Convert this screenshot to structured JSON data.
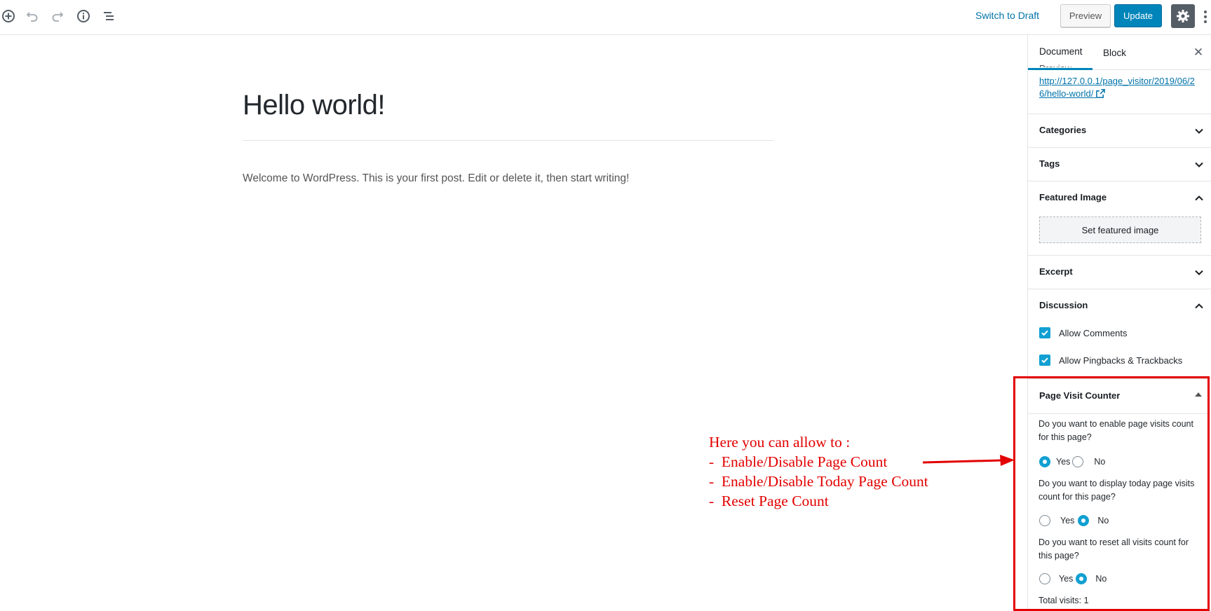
{
  "toolbar": {
    "icons": [
      "add-block-icon",
      "undo-icon",
      "redo-icon",
      "info-icon",
      "outline-icon",
      "gear-icon",
      "more-menu-icon"
    ],
    "switch_to_draft": "Switch to Draft",
    "preview": "Preview",
    "update": "Update"
  },
  "editor": {
    "title": "Hello world!",
    "body": "Welcome to WordPress. This is your first post. Edit or delete it, then start writing!"
  },
  "sidebar": {
    "tabs": [
      "Document",
      "Block"
    ],
    "active_tab": "Document",
    "preview_label": "Preview",
    "permalink": "http://127.0.0.1/page_visitor/2019/06/26/hello-world/",
    "panels": {
      "categories": "Categories",
      "tags": "Tags",
      "featured_image": "Featured Image",
      "set_featured_image": "Set featured image",
      "excerpt": "Excerpt",
      "discussion": "Discussion",
      "allow_comments": "Allow Comments",
      "allow_pingbacks": "Allow Pingbacks & Trackbacks"
    },
    "page_visit_counter": {
      "title": "Page Visit Counter",
      "q1": "Do you want to enable page visits count for this page?",
      "q2": "Do you want to display today page visits count for this page?",
      "q3": "Do you want to reset all visits count for this page?",
      "yes": "Yes",
      "no": "No",
      "q1_selected": "Yes",
      "q2_selected": "No",
      "q3_selected": "No",
      "total_visits": "Total visits: 1"
    }
  },
  "annotation": {
    "lines": [
      "Here you can allow to :",
      "-  Enable/Disable Page Count",
      "-  Enable/Disable Today Page Count",
      "-  Reset Page Count"
    ],
    "color": "#e30000"
  },
  "colors": {
    "accent": "#0085ba",
    "link": "#0073aa",
    "checkbox": "#11a0d2"
  }
}
